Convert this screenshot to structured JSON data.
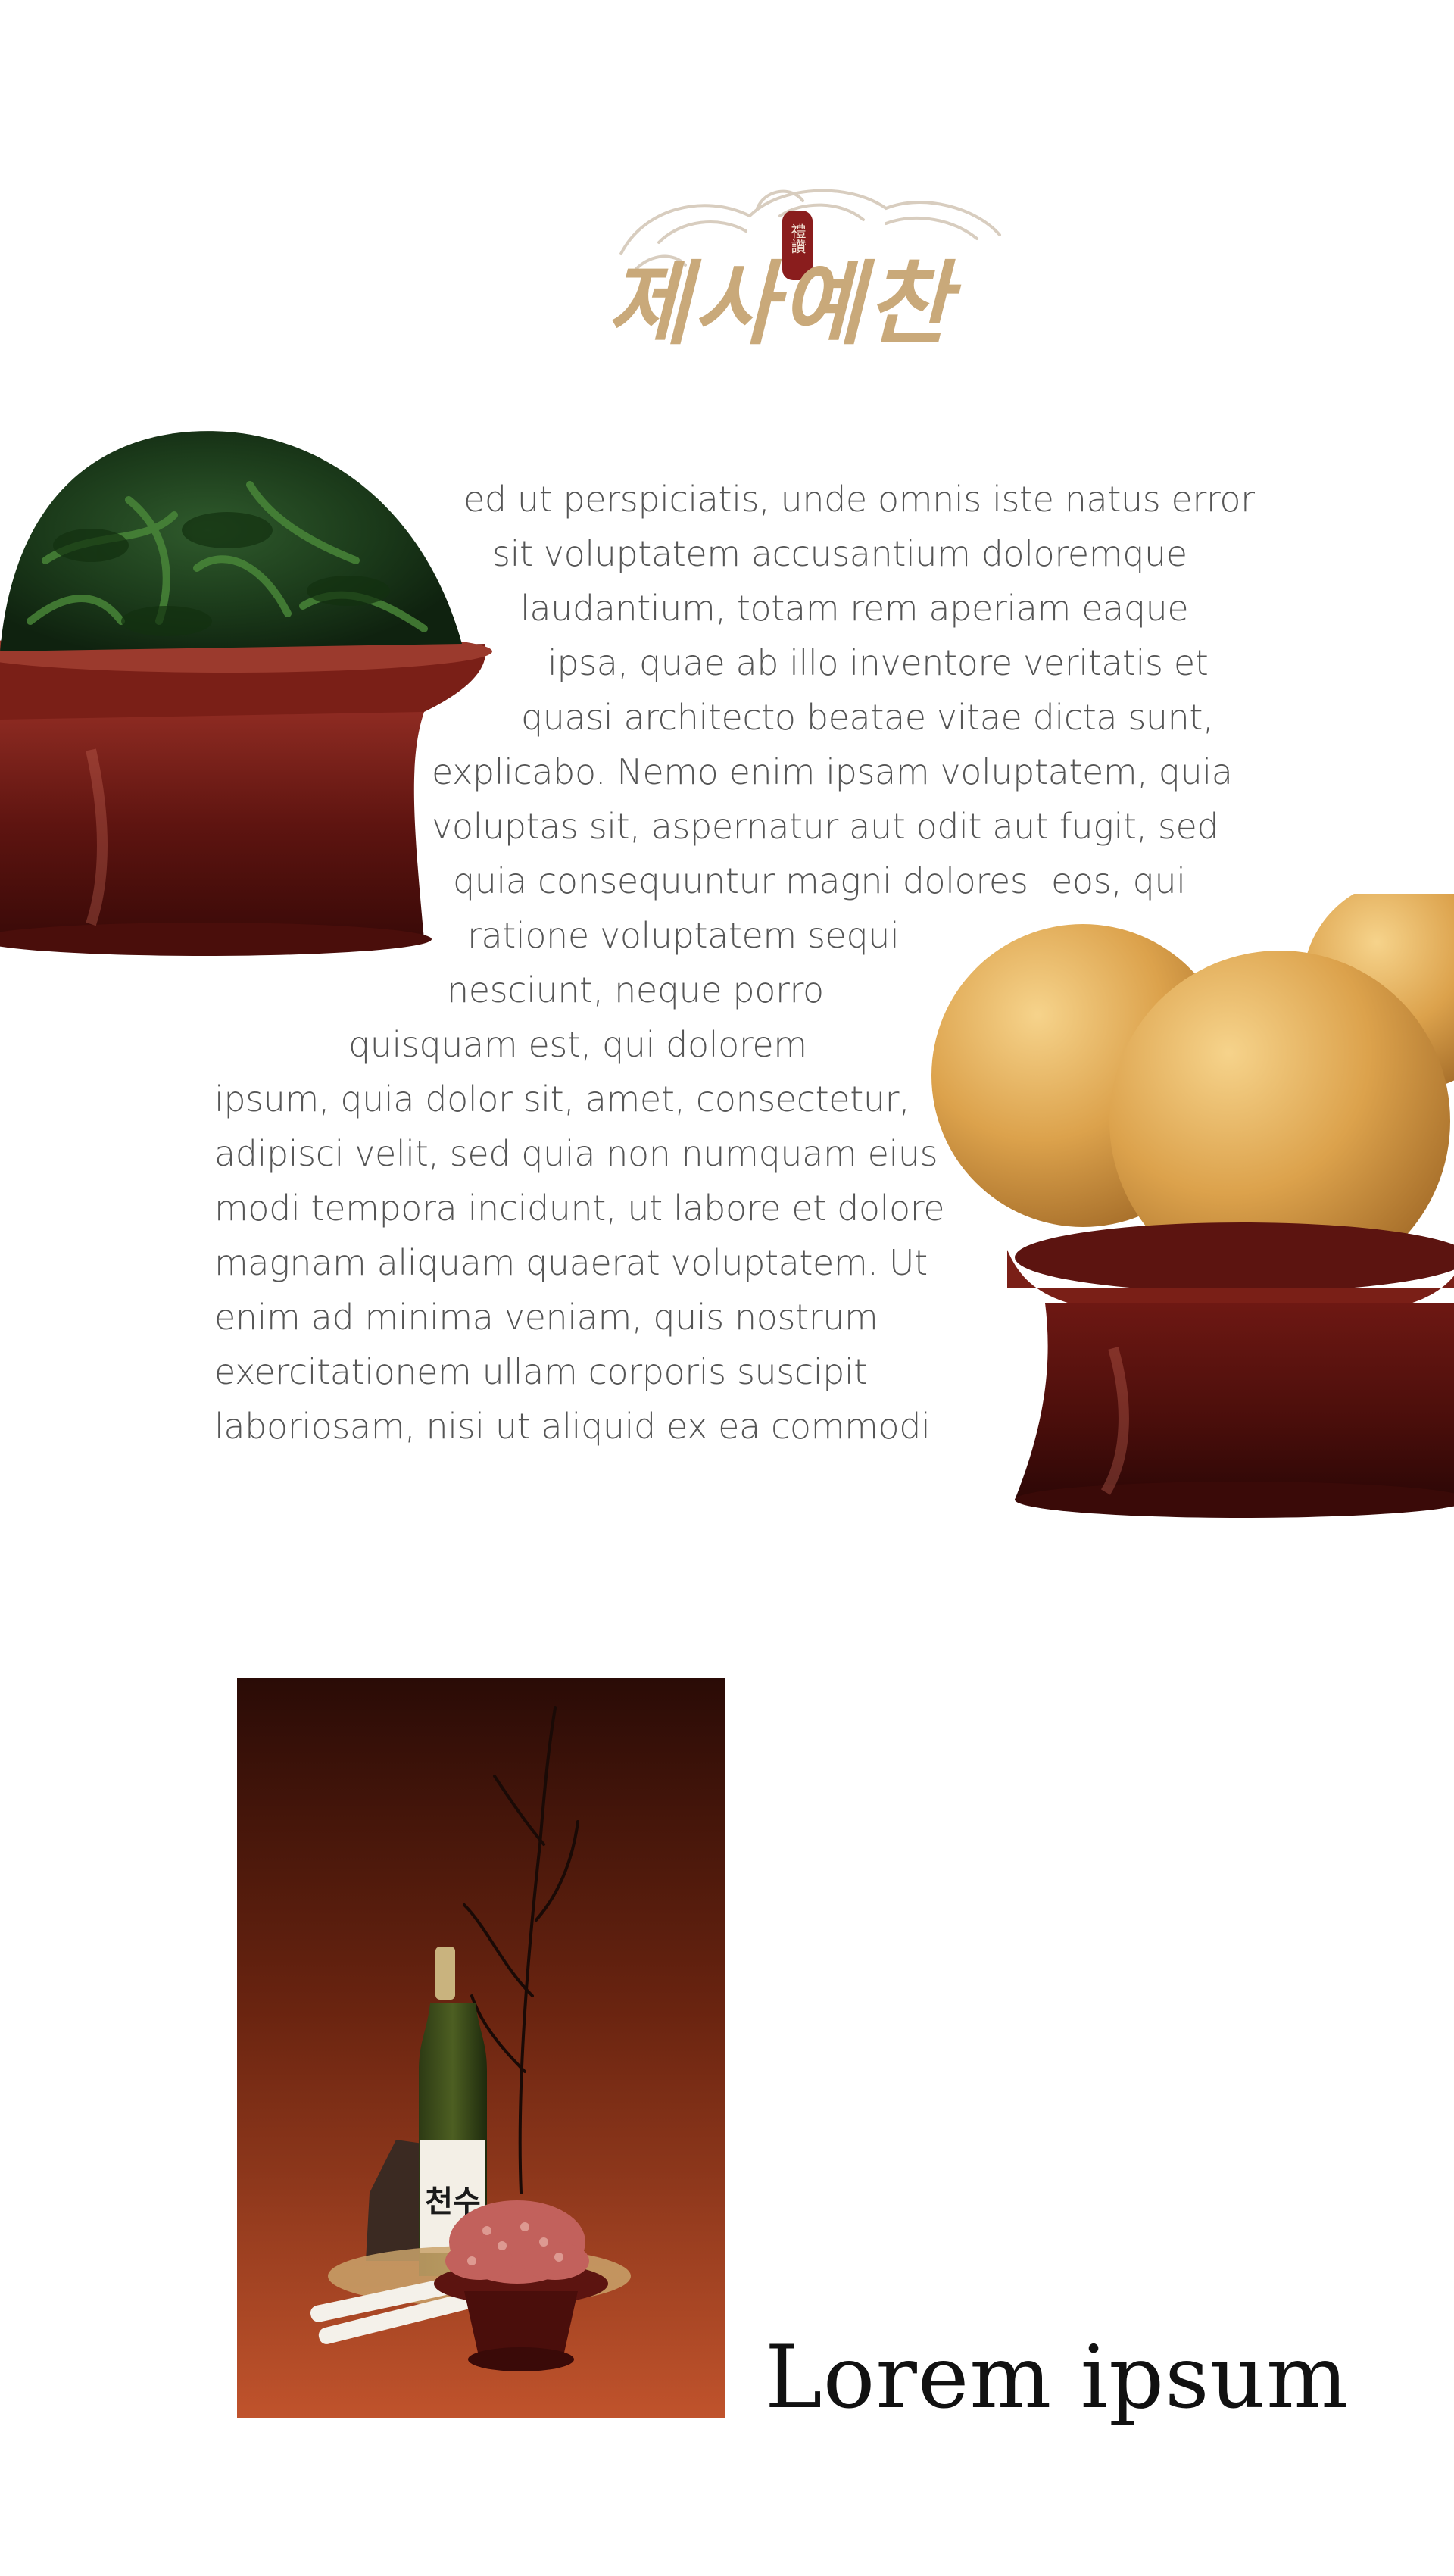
{
  "logo": {
    "wordmark": "제사예찬",
    "seal_text": "禮讚",
    "colors": {
      "wordmark": "#c9a97a",
      "seal": "#8a1d1d",
      "cloud": "#d8cdbf"
    }
  },
  "body_text": {
    "lines": [
      "ed ut perspiciatis, unde omnis iste natus error",
      "sit voluptatem accusantium doloremque",
      "laudantium, totam rem aperiam eaque",
      "ipsa, quae ab illo inventore veritatis et",
      "quasi architecto beatae vitae dicta sunt,",
      "explicabo. Nemo enim ipsam voluptatem, quia",
      "voluptas sit, aspernatur aut odit aut fugit, sed",
      "quia consequuntur magni dolores",
      "eos, qui",
      "ratione voluptatem sequi",
      "nesciunt, neque porro",
      "quisquam est, qui dolorem",
      "ipsum, quia dolor sit, amet, consectetur,",
      "adipisci velit, sed quia non numquam eius",
      "modi tempora incidunt, ut labore et dolore",
      "magnam aliquam quaerat voluptatem. Ut",
      "enim ad minima veniam, quis nostrum",
      "exercitationem ullam corporis suscipit",
      "laboriosam, nisi ut aliquid ex ea commodi"
    ]
  },
  "images": {
    "spinach": "seasoned-spinach-on-lacquered-stand",
    "pears": "korean-pears-on-lacquered-stand",
    "ritual": "ancestral-rite-still-life-with-liquor-octopus-candles",
    "bottle_label": "천수"
  },
  "footer": {
    "heading": "Lorem ipsum"
  }
}
